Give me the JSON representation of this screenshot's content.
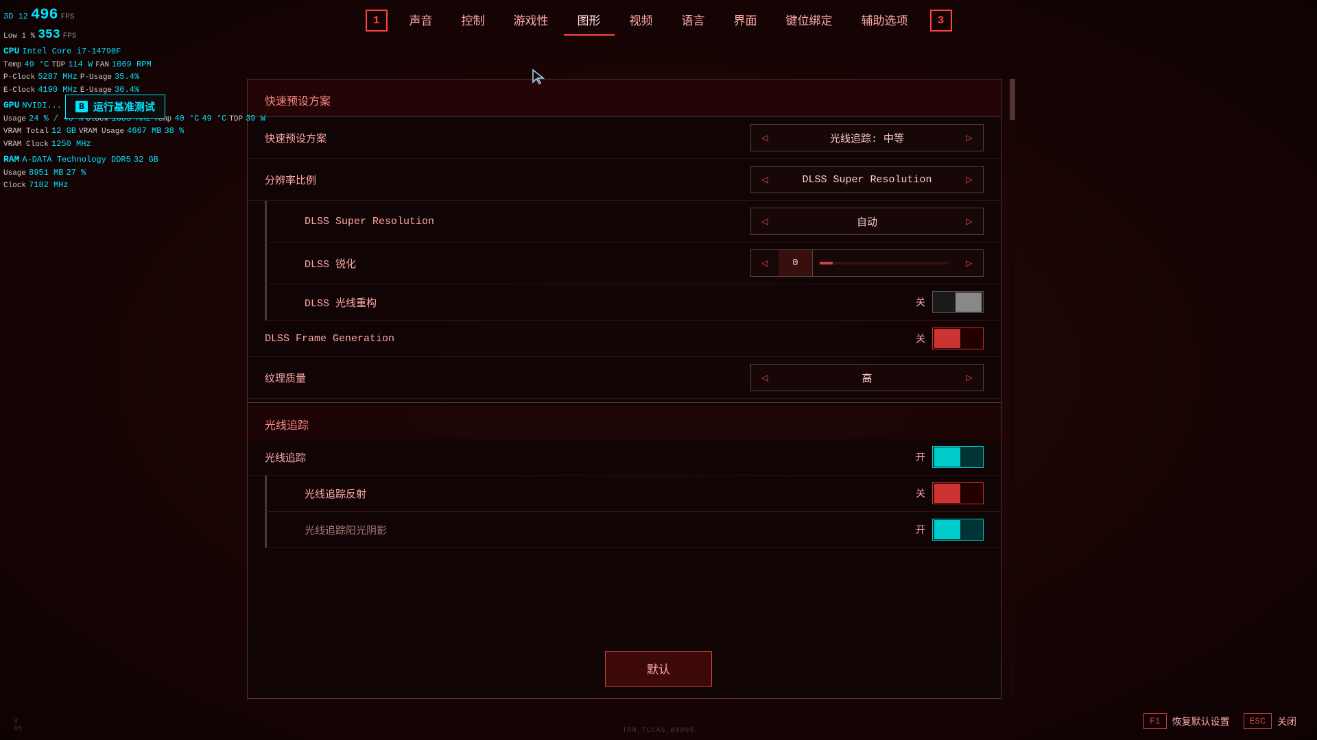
{
  "background": "#1a0505",
  "hud": {
    "d3d": "3D 12",
    "fps_val": "496",
    "fps_label": "FPS",
    "low_label": "Low 1 %",
    "low_val": "353",
    "low_fps": "FPS",
    "cpu_label": "CPU",
    "cpu_name": "Intel Core i7-14790F",
    "temp_label": "Temp",
    "temp_val": "49",
    "temp_unit": "°C",
    "tdp_label": "TDP",
    "tdp_val": "114",
    "tdp_unit": "W",
    "fan_label": "FAN",
    "fan_val": "1069",
    "fan_unit": "RPM",
    "pclock_label": "P-Clock",
    "pclock_val": "5287",
    "pclock_unit": "MHz",
    "pusage_label": "P-Usage",
    "pusage_val": "35.4",
    "pusage_unit": "%",
    "eclock_label": "E-Clock",
    "eclock_val": "4190",
    "eclock_unit": "MHz",
    "eusage_label": "E-Usage",
    "eusage_val": "30.4",
    "eusage_unit": "%",
    "gpu_label": "GPU",
    "gpu_name": "NVIDI...",
    "usage_label": "Usage",
    "usage_val": "24",
    "usage_max": "40",
    "usage_unit": "%",
    "clock_label": "Clock",
    "clock_val": "1605",
    "clock_unit": "MHz",
    "gtemp_val": "40",
    "gtemp_unit": "°C",
    "gtemp2_val": "49",
    "gtemp2_unit": "°C",
    "gtdp_label": "TDP",
    "gtdp_val": "39",
    "gtdp_unit": "W",
    "vram_total_label": "VRAM Total",
    "vram_total_val": "12",
    "vram_total_unit": "GB",
    "vram_usage_label": "VRAM Usage",
    "vram_usage_val": "4667",
    "vram_usage_unit": "MB",
    "vram_usage_pct": "38",
    "vram_clock_label": "VRAM Clock",
    "vram_clock_val": "1250",
    "vram_clock_unit": "MHz",
    "ram_label": "RAM",
    "ram_brand": "A-DATA Technology DDR5",
    "ram_size": "32",
    "ram_unit": "GB",
    "ram_usage_label": "Usage",
    "ram_usage_val": "8951",
    "ram_usage_unit": "MB",
    "ram_usage_pct": "27",
    "ram_clock_label": "Clock",
    "ram_clock_val": "7182",
    "ram_clock_unit": "MHz"
  },
  "benchmark": {
    "key": "B",
    "text": "运行基准测试"
  },
  "nav": {
    "left_badge": "1",
    "right_badge": "3",
    "tabs": [
      "声音",
      "控制",
      "游戏性",
      "图形",
      "视频",
      "语言",
      "界面",
      "键位绑定",
      "辅助选项"
    ],
    "active_tab": "图形"
  },
  "panel": {
    "preset_section": "快速预设方案",
    "preset_row_label": "快速预设方案",
    "preset_value": "光线追踪: 中等",
    "resolution_label": "分辨率比例",
    "resolution_value": "DLSS Super Resolution",
    "dlss_label": "DLSS Super Resolution",
    "dlss_value": "自动",
    "dlss_sharpen_label": "DLSS 锐化",
    "dlss_sharpen_value": "0",
    "dlss_recon_label": "DLSS 光线重构",
    "dlss_recon_toggle": "关",
    "dlss_framegen_label": "DLSS Frame Generation",
    "dlss_framegen_toggle": "关",
    "texture_label": "纹理质量",
    "texture_value": "高",
    "raytracing_section": "光线追踪",
    "rt_label": "光线追踪",
    "rt_toggle": "开",
    "rt_reflect_label": "光线追踪反射",
    "rt_reflect_toggle": "关",
    "rt_shadow_label": "光线追踪阳光阴影",
    "rt_shadow_toggle": "开",
    "default_btn": "默认"
  },
  "bottom": {
    "f1_key": "F1",
    "f1_label": "恢复默认设置",
    "esc_key": "ESC",
    "esc_label": "关闭"
  },
  "footer": {
    "version": "V 05",
    "center_text": "TRN_TLCAS_B0095",
    "right_symbol": "◁▷"
  }
}
